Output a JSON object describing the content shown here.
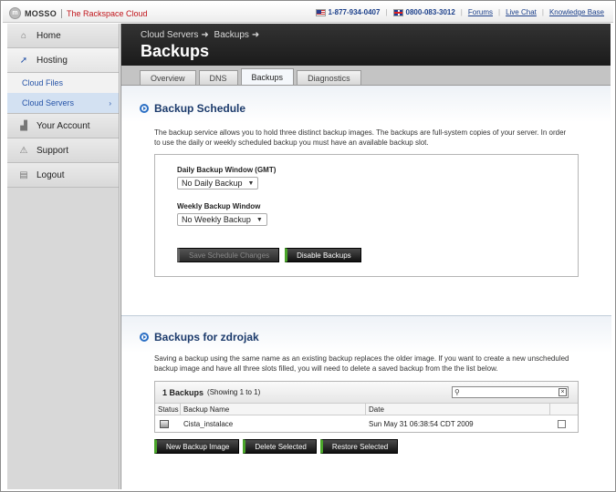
{
  "topbar": {
    "brand": "MOSSO",
    "brand_sub": "The Rackspace Cloud",
    "phone_us": "1-877-934-0407",
    "phone_uk": "0800-083-3012",
    "links": [
      "Forums",
      "Live Chat",
      "Knowledge Base"
    ]
  },
  "sidebar": {
    "items": [
      {
        "label": "Home",
        "icon": "home-icon"
      },
      {
        "label": "Hosting",
        "icon": "cursor-icon"
      },
      {
        "label": "Your Account",
        "icon": "bar-chart-icon"
      },
      {
        "label": "Support",
        "icon": "warning-icon"
      },
      {
        "label": "Logout",
        "icon": "logout-icon"
      }
    ],
    "sub_items": [
      {
        "label": "Cloud Files"
      },
      {
        "label": "Cloud Servers"
      }
    ]
  },
  "header": {
    "breadcrumb": [
      "Cloud Servers",
      "Backups"
    ],
    "title": "Backups"
  },
  "tabs": [
    "Overview",
    "DNS",
    "Backups",
    "Diagnostics"
  ],
  "schedule": {
    "title": "Backup Schedule",
    "description": "The backup service allows you to hold three distinct backup images. The backups are full-system copies of your server. In order to use the daily or weekly scheduled backup you must have an available backup slot.",
    "daily_label": "Daily Backup Window (GMT)",
    "daily_value": "No Daily Backup",
    "weekly_label": "Weekly Backup Window",
    "weekly_value": "No Weekly Backup",
    "save_label": "Save Schedule Changes",
    "disable_label": "Disable Backups"
  },
  "backups": {
    "title": "Backups for zdrojak",
    "description": "Saving a backup using the same name as an existing backup replaces the older image. If you want to create a new unscheduled backup image and have all three slots filled, you will need to delete a saved backup from the the list below.",
    "count_label": "1 Backups",
    "showing": "(Showing 1 to 1)",
    "columns": [
      "Status",
      "Backup Name",
      "Date"
    ],
    "rows": [
      {
        "name": "Cista_instalace",
        "date": "Sun May 31 06:38:54 CDT 2009"
      }
    ],
    "buttons": [
      "New Backup Image",
      "Delete Selected",
      "Restore Selected"
    ]
  }
}
